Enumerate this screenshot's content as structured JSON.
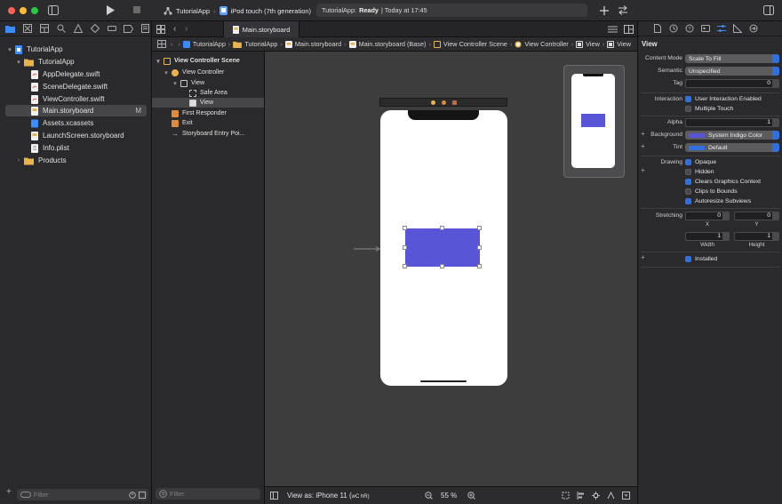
{
  "toolbar": {
    "project": "TutorialApp",
    "device": "iPod touch (7th generation)",
    "status_app": "TutorialApp:",
    "status_state": "Ready",
    "status_time": "| Today at 17:45"
  },
  "navigator": {
    "items": [
      {
        "label": "TutorialApp",
        "kind": "project",
        "indent": 0,
        "disclosure": "▾"
      },
      {
        "label": "TutorialApp",
        "kind": "folder",
        "indent": 1,
        "disclosure": "▾"
      },
      {
        "label": "AppDelegate.swift",
        "kind": "swift",
        "indent": 2
      },
      {
        "label": "SceneDelegate.swift",
        "kind": "swift",
        "indent": 2
      },
      {
        "label": "ViewController.swift",
        "kind": "swift",
        "indent": 2
      },
      {
        "label": "Main.storyboard",
        "kind": "storyboard",
        "indent": 2,
        "badge": "M"
      },
      {
        "label": "Assets.xcassets",
        "kind": "assets",
        "indent": 2
      },
      {
        "label": "LaunchScreen.storyboard",
        "kind": "storyboard",
        "indent": 2
      },
      {
        "label": "Info.plist",
        "kind": "plist",
        "indent": 2
      },
      {
        "label": "Products",
        "kind": "folder",
        "indent": 1,
        "disclosure": "›"
      }
    ],
    "filter_placeholder": "Filter"
  },
  "editor": {
    "tab": "Main.storyboard",
    "breadcrumbs": [
      "TutorialApp",
      "TutorialApp",
      "Main.storyboard",
      "Main.storyboard (Base)",
      "View Controller Scene",
      "View Controller",
      "View",
      "View"
    ]
  },
  "outline": {
    "items": [
      {
        "label": "View Controller Scene",
        "indent": 0,
        "disclosure": "▾",
        "bold": true
      },
      {
        "label": "View Controller",
        "indent": 1,
        "disclosure": "▾"
      },
      {
        "label": "View",
        "indent": 2,
        "disclosure": "▾"
      },
      {
        "label": "Safe Area",
        "indent": 3
      },
      {
        "label": "View",
        "indent": 3
      },
      {
        "label": "First Responder",
        "indent": 1
      },
      {
        "label": "Exit",
        "indent": 1
      },
      {
        "label": "Storyboard Entry Poi...",
        "indent": 1
      }
    ],
    "filter_placeholder": "Filter"
  },
  "canvas": {
    "view_as": "View as: iPhone 11 (",
    "view_as_suffix": "wC hR)",
    "zoom": "55 %",
    "rect_color": "#5856d6"
  },
  "inspector": {
    "section_title": "View",
    "content_mode_label": "Content Mode",
    "content_mode": "Scale To Fill",
    "semantic_label": "Semantic",
    "semantic": "Unspecified",
    "tag_label": "Tag",
    "tag": "0",
    "interaction_label": "Interaction",
    "user_interaction": "User Interaction Enabled",
    "multiple_touch": "Multiple Touch",
    "alpha_label": "Alpha",
    "alpha": "1",
    "background_label": "Background",
    "background": "System Indigo Color",
    "tint_label": "Tint",
    "tint": "Default",
    "drawing_label": "Drawing",
    "opaque": "Opaque",
    "hidden": "Hidden",
    "clears": "Clears Graphics Context",
    "clips": "Clips to Bounds",
    "autoresize": "Autoresize Subviews",
    "stretching_label": "Stretching",
    "stretch_x": "0",
    "stretch_y": "0",
    "stretch_w": "1",
    "stretch_h": "1",
    "x_label": "X",
    "y_label": "Y",
    "width_label": "Width",
    "height_label": "Height",
    "installed": "Installed"
  }
}
